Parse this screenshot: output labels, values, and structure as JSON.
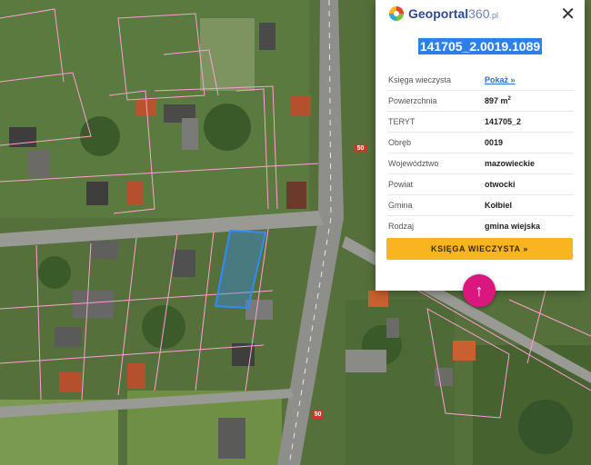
{
  "logo": {
    "brand": "Geoportal",
    "brand_suffix": "360",
    "domain": ".pl"
  },
  "parcel": {
    "id": "141705_2.0019.1089",
    "fields": [
      {
        "key": "Księga wieczysta",
        "value": "Pokaż »",
        "link": true
      },
      {
        "key": "Powierzchnia",
        "value": "897 m",
        "sup": "2"
      },
      {
        "key": "TERYT",
        "value": "141705_2"
      },
      {
        "key": "Obręb",
        "value": "0019"
      },
      {
        "key": "Województwo",
        "value": "mazowieckie"
      },
      {
        "key": "Powiat",
        "value": "otwocki"
      },
      {
        "key": "Gmina",
        "value": "Kołbiel"
      },
      {
        "key": "Rodzaj",
        "value": "gmina wiejska"
      }
    ],
    "button_label": "KSIĘGA WIECZYSTA »"
  },
  "close_symbol": "✕",
  "scroll_up_symbol": "↑",
  "road_labels": [
    "50",
    "50"
  ],
  "colors": {
    "accent": "#f8b51f",
    "fab": "#d9177e",
    "highlight": "#2f7fe8",
    "parcel_border": "#ff9fd1",
    "selected_parcel": "#2f8cff"
  }
}
